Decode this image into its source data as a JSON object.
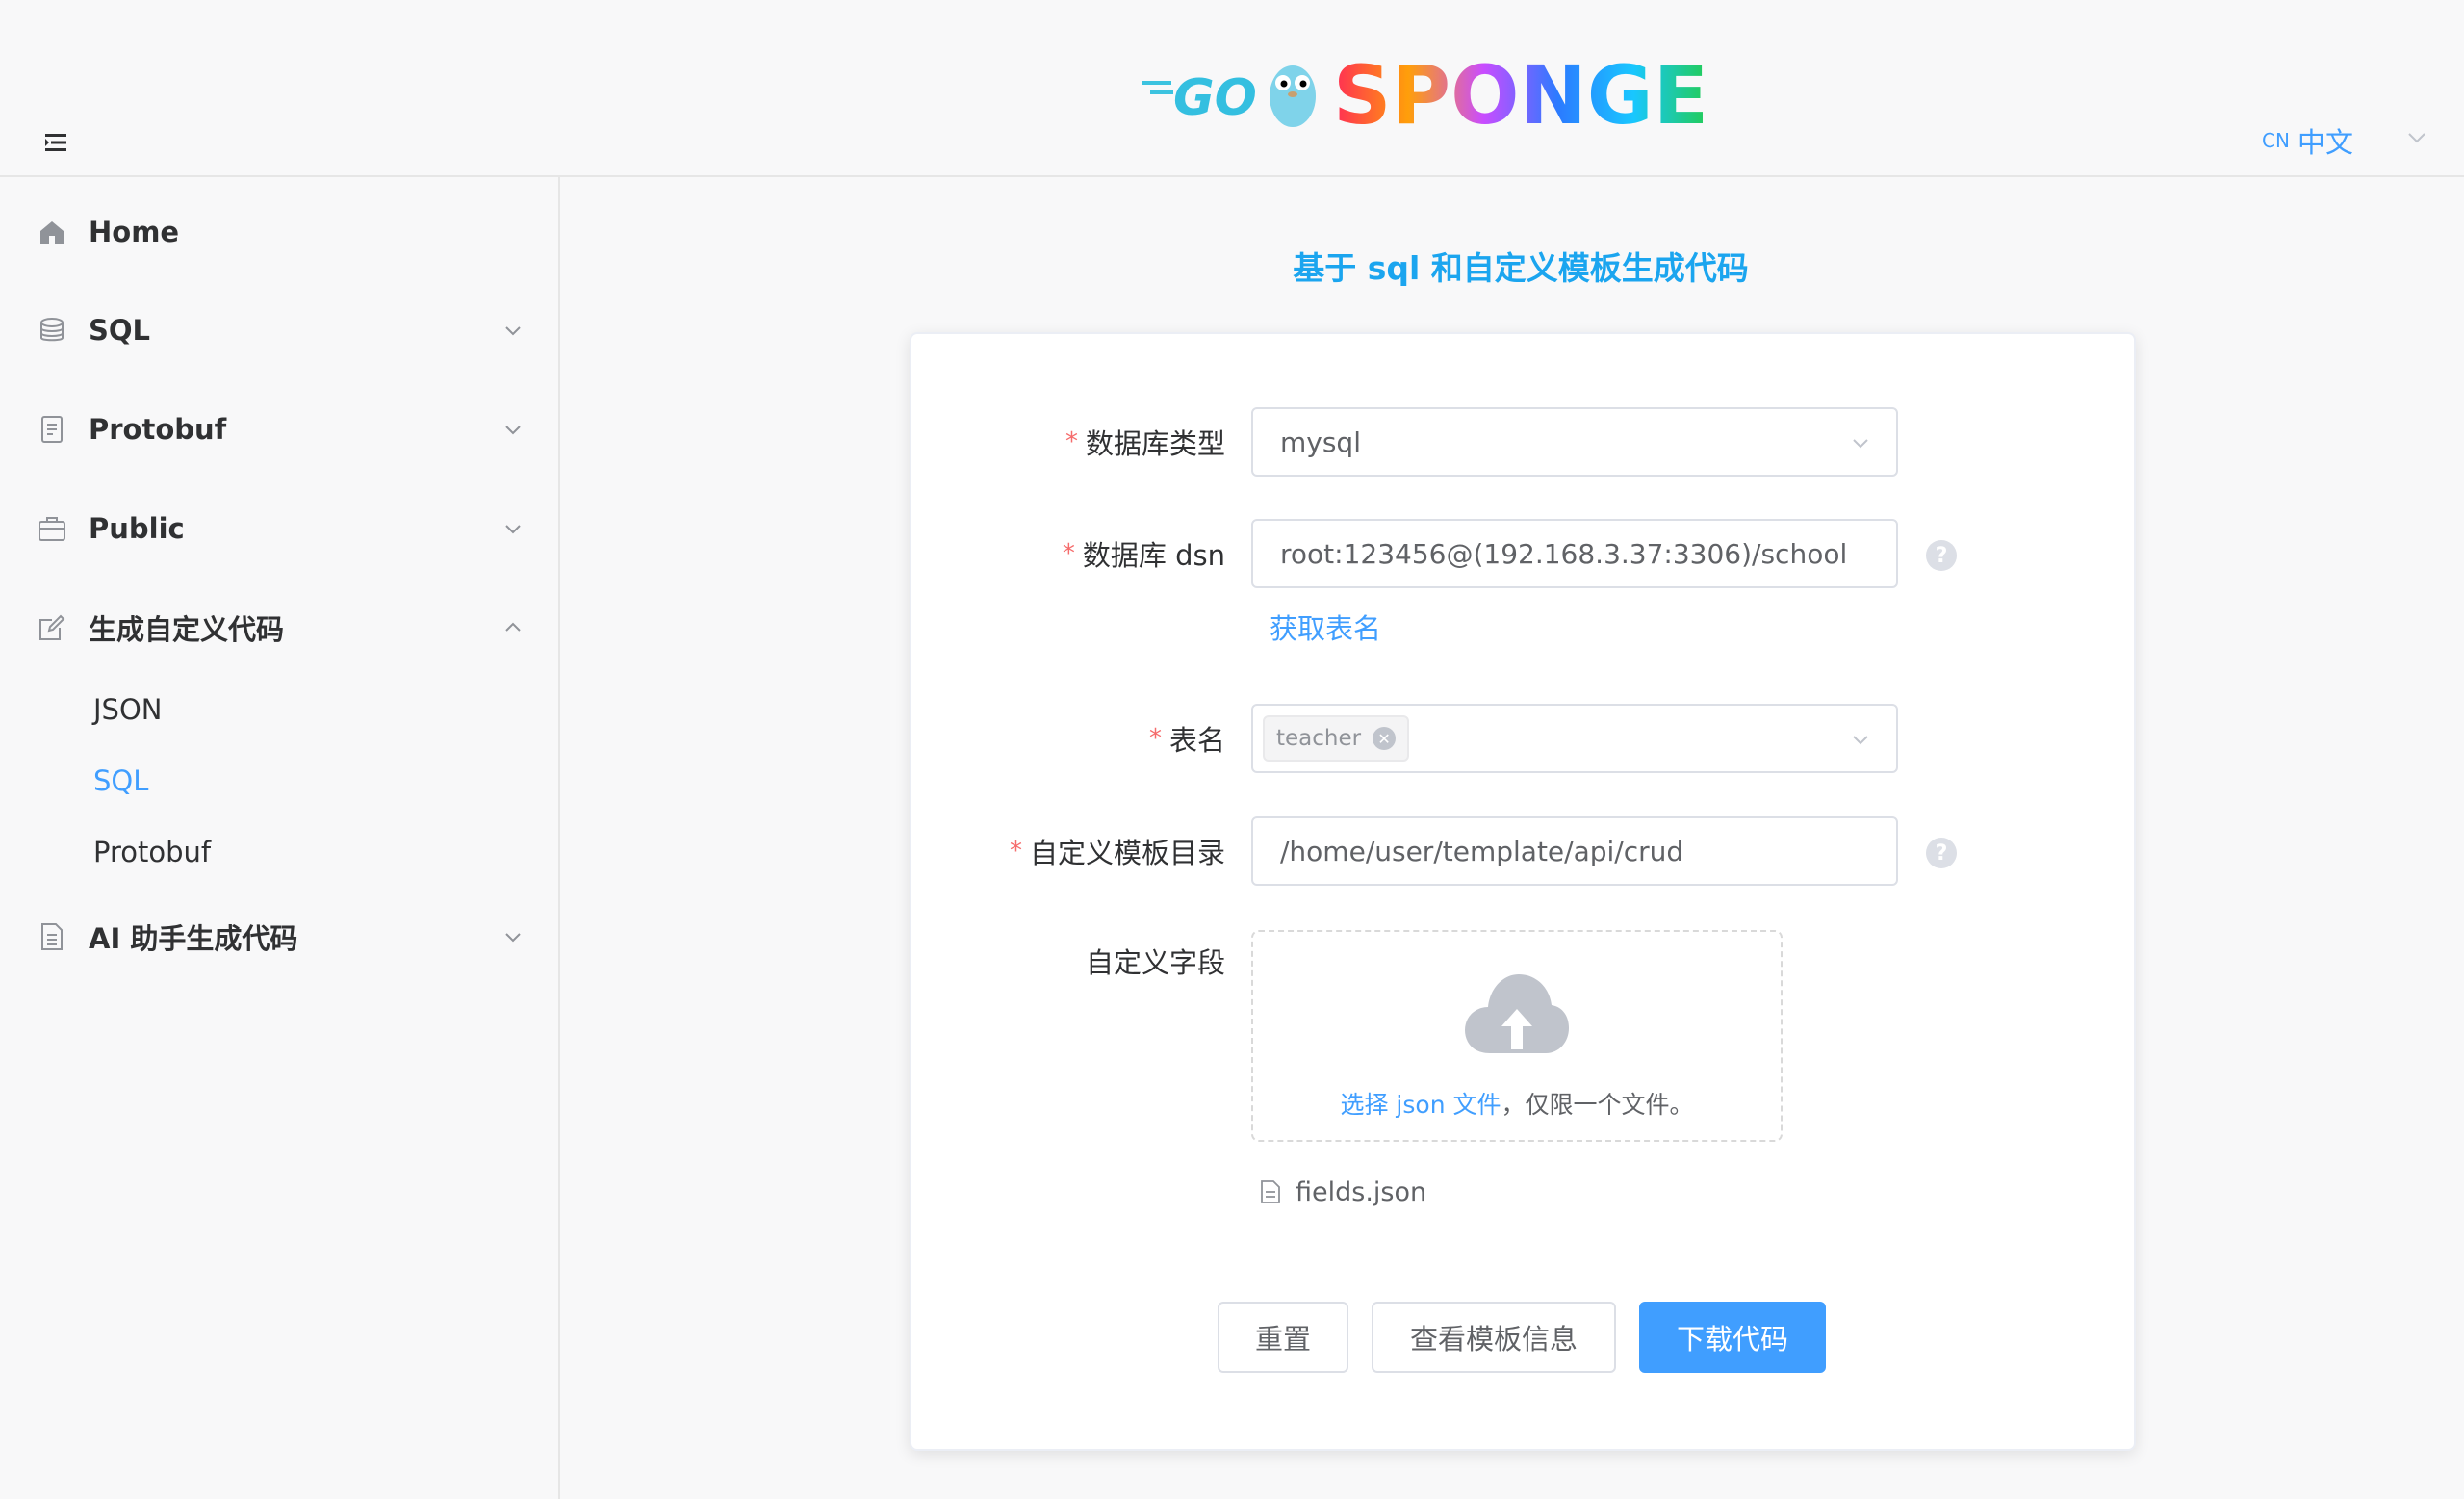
{
  "header": {
    "logo_go": "GO",
    "logo_sponge": "SPONGE",
    "lang_code": "CN",
    "lang_label": "中文"
  },
  "sidebar": {
    "items": [
      {
        "label": "Home",
        "icon": "home-icon"
      },
      {
        "label": "SQL",
        "icon": "database-icon"
      },
      {
        "label": "Protobuf",
        "icon": "document-icon"
      },
      {
        "label": "Public",
        "icon": "briefcase-icon"
      },
      {
        "label": "生成自定义代码",
        "icon": "edit-icon",
        "expanded": true
      },
      {
        "label": "AI 助手生成代码",
        "icon": "document-icon"
      }
    ],
    "sub_items": [
      {
        "label": "JSON"
      },
      {
        "label": "SQL",
        "active": true
      },
      {
        "label": "Protobuf"
      }
    ]
  },
  "main": {
    "title": "基于 sql 和自定义模板生成代码",
    "form": {
      "db_type_label": "数据库类型",
      "db_type_value": "mysql",
      "dsn_label": "数据库 dsn",
      "dsn_value": "root:123456@(192.168.3.37:3306)/school",
      "fetch_tables_link": "获取表名",
      "table_label": "表名",
      "table_tag": "teacher",
      "template_dir_label": "自定义模板目录",
      "template_dir_value": "/home/user/template/api/crud",
      "custom_fields_label": "自定义字段",
      "upload_link": "选择 json 文件",
      "upload_hint": "，仅限一个文件。",
      "uploaded_file": "fields.json",
      "help_symbol": "?",
      "required_mark": "*"
    },
    "buttons": {
      "reset": "重置",
      "view_template": "查看模板信息",
      "download": "下载代码"
    }
  },
  "colors": {
    "accent": "#409eff",
    "title": "#1ba5ef",
    "required": "#f56c6c"
  }
}
